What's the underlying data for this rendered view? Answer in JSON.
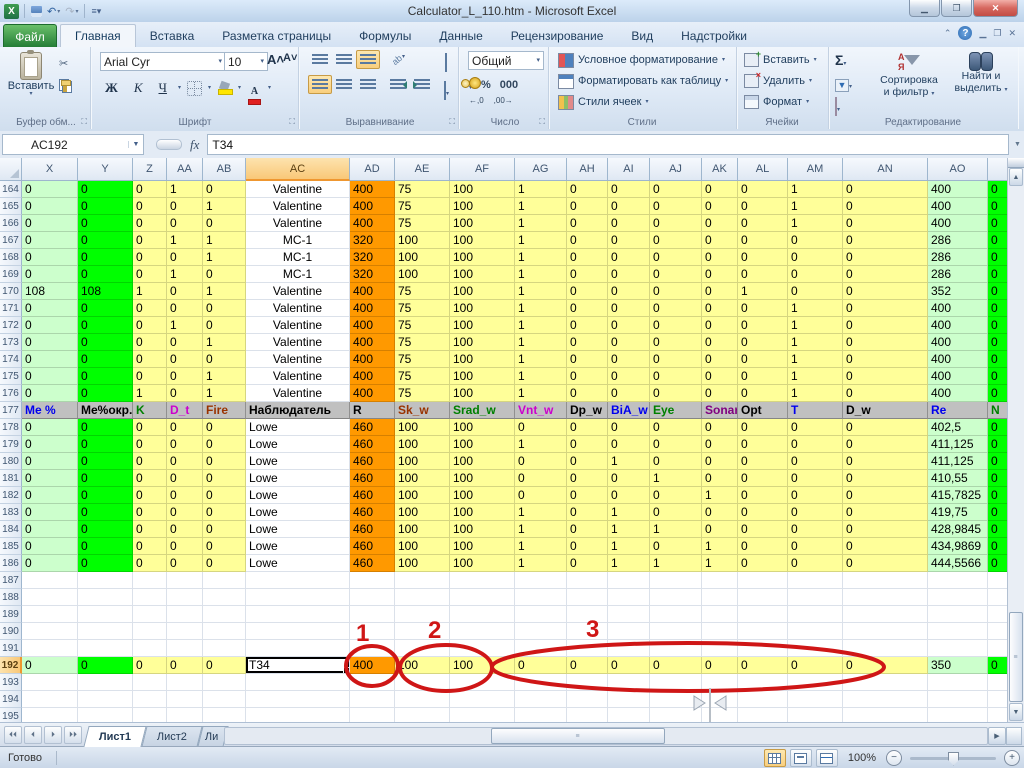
{
  "colors": {
    "pale_green": "#ccffcc",
    "bright_green": "#00ff00",
    "pale_yellow": "#ffff99",
    "orange": "#ff9900",
    "white": "#ffffff",
    "header_gray": "#c0c0c0",
    "annotation_red": "#cf1616",
    "selected_header_amber": "#f9c878"
  },
  "titlebar": {
    "title": "Calculator_L_110.htm  -  Microsoft Excel"
  },
  "tabs": {
    "file": "Файл",
    "items": [
      "Главная",
      "Вставка",
      "Разметка страницы",
      "Формулы",
      "Данные",
      "Рецензирование",
      "Вид",
      "Надстройки"
    ],
    "active": "Главная"
  },
  "ribbon": {
    "clipboard": {
      "paste": "Вставить",
      "label": "Буфер обм..."
    },
    "font": {
      "name": "Arial Cyr",
      "size": "10",
      "bold": "Ж",
      "italic": "К",
      "underline": "Ч",
      "label": "Шрифт"
    },
    "alignment": {
      "label": "Выравнивание"
    },
    "number": {
      "format": "Общий",
      "percent": "%",
      "zeros": "000",
      "inc_decimal": "←,0",
      "dec_decimal": ",00→",
      "label": "Число"
    },
    "styles": {
      "conditional": "Условное форматирование",
      "format_table": "Форматировать как таблицу",
      "cell_styles": "Стили ячеек",
      "label": "Стили"
    },
    "cells": {
      "insert": "Вставить",
      "delete": "Удалить",
      "format": "Формат",
      "label": "Ячейки"
    },
    "editing": {
      "sigma": "Σ",
      "sort": [
        "Сортировка",
        "и фильтр"
      ],
      "find": [
        "Найти и",
        "выделить"
      ],
      "label": "Редактирование"
    }
  },
  "formula_bar": {
    "name_box": "AC192",
    "fx": "fx",
    "value": "T34"
  },
  "grid": {
    "columns": [
      "X",
      "Y",
      "Z",
      "AA",
      "AB",
      "AC",
      "AD",
      "AE",
      "AF",
      "AG",
      "AH",
      "AI",
      "AJ",
      "AK",
      "AL",
      "AM",
      "AN",
      "AO"
    ],
    "selected_column": "AC",
    "selected_row": "192",
    "column_fills": [
      "pale_green",
      "bright_green",
      "pale_yellow",
      "pale_yellow",
      "pale_yellow",
      "white",
      "orange",
      "pale_yellow",
      "pale_yellow",
      "pale_yellow",
      "pale_yellow",
      "pale_yellow",
      "pale_yellow",
      "pale_yellow",
      "pale_yellow",
      "pale_yellow",
      "pale_yellow",
      "pale_green",
      "bright_green"
    ],
    "header_row_styles": [
      "blue",
      "black",
      "green",
      "magenta",
      "brown",
      "black",
      "black",
      "brown",
      "green",
      "magenta",
      "black",
      "blue",
      "green",
      "purple",
      "black",
      "blue",
      "black",
      "blue",
      "green"
    ],
    "rows": [
      {
        "n": "164",
        "type": "data",
        "ac": "center",
        "cells": [
          "0",
          "0",
          "0",
          "1",
          "0",
          "Valentine",
          "400",
          "75",
          "100",
          "1",
          "0",
          "0",
          "0",
          "0",
          "0",
          "1",
          "0",
          "400",
          "0"
        ]
      },
      {
        "n": "165",
        "type": "data",
        "ac": "center",
        "cells": [
          "0",
          "0",
          "0",
          "0",
          "1",
          "Valentine",
          "400",
          "75",
          "100",
          "1",
          "0",
          "0",
          "0",
          "0",
          "0",
          "1",
          "0",
          "400",
          "0"
        ]
      },
      {
        "n": "166",
        "type": "data",
        "ac": "center",
        "cells": [
          "0",
          "0",
          "0",
          "0",
          "0",
          "Valentine",
          "400",
          "75",
          "100",
          "1",
          "0",
          "0",
          "0",
          "0",
          "0",
          "1",
          "0",
          "400",
          "0"
        ]
      },
      {
        "n": "167",
        "type": "data",
        "ac": "center",
        "cells": [
          "0",
          "0",
          "0",
          "1",
          "1",
          "MC-1",
          "320",
          "100",
          "100",
          "1",
          "0",
          "0",
          "0",
          "0",
          "0",
          "0",
          "0",
          "286",
          "0"
        ]
      },
      {
        "n": "168",
        "type": "data",
        "ac": "center",
        "cells": [
          "0",
          "0",
          "0",
          "0",
          "1",
          "MC-1",
          "320",
          "100",
          "100",
          "1",
          "0",
          "0",
          "0",
          "0",
          "0",
          "0",
          "0",
          "286",
          "0"
        ]
      },
      {
        "n": "169",
        "type": "data",
        "ac": "center",
        "cells": [
          "0",
          "0",
          "0",
          "1",
          "0",
          "MC-1",
          "320",
          "100",
          "100",
          "1",
          "0",
          "0",
          "0",
          "0",
          "0",
          "0",
          "0",
          "286",
          "0"
        ]
      },
      {
        "n": "170",
        "type": "data",
        "ac": "center",
        "cells": [
          "108",
          "108",
          "1",
          "0",
          "1",
          "Valentine",
          "400",
          "75",
          "100",
          "1",
          "0",
          "0",
          "0",
          "0",
          "1",
          "0",
          "0",
          "352",
          "0"
        ]
      },
      {
        "n": "171",
        "type": "data",
        "ac": "center",
        "cells": [
          "0",
          "0",
          "0",
          "0",
          "0",
          "Valentine",
          "400",
          "75",
          "100",
          "1",
          "0",
          "0",
          "0",
          "0",
          "0",
          "1",
          "0",
          "400",
          "0"
        ]
      },
      {
        "n": "172",
        "type": "data",
        "ac": "center",
        "cells": [
          "0",
          "0",
          "0",
          "1",
          "0",
          "Valentine",
          "400",
          "75",
          "100",
          "1",
          "0",
          "0",
          "0",
          "0",
          "0",
          "1",
          "0",
          "400",
          "0"
        ]
      },
      {
        "n": "173",
        "type": "data",
        "ac": "center",
        "cells": [
          "0",
          "0",
          "0",
          "0",
          "1",
          "Valentine",
          "400",
          "75",
          "100",
          "1",
          "0",
          "0",
          "0",
          "0",
          "0",
          "1",
          "0",
          "400",
          "0"
        ]
      },
      {
        "n": "174",
        "type": "data",
        "ac": "center",
        "cells": [
          "0",
          "0",
          "0",
          "0",
          "0",
          "Valentine",
          "400",
          "75",
          "100",
          "1",
          "0",
          "0",
          "0",
          "0",
          "0",
          "1",
          "0",
          "400",
          "0"
        ]
      },
      {
        "n": "175",
        "type": "data",
        "ac": "center",
        "cells": [
          "0",
          "0",
          "0",
          "0",
          "1",
          "Valentine",
          "400",
          "75",
          "100",
          "1",
          "0",
          "0",
          "0",
          "0",
          "0",
          "1",
          "0",
          "400",
          "0"
        ]
      },
      {
        "n": "176",
        "type": "data",
        "ac": "center",
        "cells": [
          "0",
          "0",
          "1",
          "0",
          "1",
          "Valentine",
          "400",
          "75",
          "100",
          "1",
          "0",
          "0",
          "0",
          "0",
          "0",
          "1",
          "0",
          "400",
          "0"
        ]
      },
      {
        "n": "177",
        "type": "header",
        "cells": [
          "Me %",
          "Ме%окр.",
          "K",
          "D_t",
          "Fire",
          "Наблюдатель",
          "R",
          "Sk_w",
          "Srad_w",
          "Vnt_w",
          "Dp_w",
          "BiA_w",
          "Eye",
          "Sonar",
          "Opt",
          "T",
          "D_w",
          "Re",
          "N"
        ]
      },
      {
        "n": "178",
        "type": "data",
        "ac": "left",
        "cells": [
          "0",
          "0",
          "0",
          "0",
          "0",
          "Lowe",
          "460",
          "100",
          "100",
          "0",
          "0",
          "0",
          "0",
          "0",
          "0",
          "0",
          "0",
          "402,5",
          "0"
        ]
      },
      {
        "n": "179",
        "type": "data",
        "ac": "left",
        "cells": [
          "0",
          "0",
          "0",
          "0",
          "0",
          "Lowe",
          "460",
          "100",
          "100",
          "1",
          "0",
          "0",
          "0",
          "0",
          "0",
          "0",
          "0",
          "411,125",
          "0"
        ]
      },
      {
        "n": "180",
        "type": "data",
        "ac": "left",
        "cells": [
          "0",
          "0",
          "0",
          "0",
          "0",
          "Lowe",
          "460",
          "100",
          "100",
          "0",
          "0",
          "1",
          "0",
          "0",
          "0",
          "0",
          "0",
          "411,125",
          "0"
        ]
      },
      {
        "n": "181",
        "type": "data",
        "ac": "left",
        "cells": [
          "0",
          "0",
          "0",
          "0",
          "0",
          "Lowe",
          "460",
          "100",
          "100",
          "0",
          "0",
          "0",
          "1",
          "0",
          "0",
          "0",
          "0",
          "410,55",
          "0"
        ]
      },
      {
        "n": "182",
        "type": "data",
        "ac": "left",
        "cells": [
          "0",
          "0",
          "0",
          "0",
          "0",
          "Lowe",
          "460",
          "100",
          "100",
          "0",
          "0",
          "0",
          "0",
          "1",
          "0",
          "0",
          "0",
          "415,7825",
          "0"
        ]
      },
      {
        "n": "183",
        "type": "data",
        "ac": "left",
        "cells": [
          "0",
          "0",
          "0",
          "0",
          "0",
          "Lowe",
          "460",
          "100",
          "100",
          "1",
          "0",
          "1",
          "0",
          "0",
          "0",
          "0",
          "0",
          "419,75",
          "0"
        ]
      },
      {
        "n": "184",
        "type": "data",
        "ac": "left",
        "cells": [
          "0",
          "0",
          "0",
          "0",
          "0",
          "Lowe",
          "460",
          "100",
          "100",
          "1",
          "0",
          "1",
          "1",
          "0",
          "0",
          "0",
          "0",
          "428,9845",
          "0"
        ]
      },
      {
        "n": "185",
        "type": "data",
        "ac": "left",
        "cells": [
          "0",
          "0",
          "0",
          "0",
          "0",
          "Lowe",
          "460",
          "100",
          "100",
          "1",
          "0",
          "1",
          "0",
          "1",
          "0",
          "0",
          "0",
          "434,9869",
          "0"
        ]
      },
      {
        "n": "186",
        "type": "data",
        "ac": "left",
        "cells": [
          "0",
          "0",
          "0",
          "0",
          "0",
          "Lowe",
          "460",
          "100",
          "100",
          "1",
          "0",
          "1",
          "1",
          "1",
          "0",
          "0",
          "0",
          "444,5566",
          "0"
        ]
      },
      {
        "n": "187",
        "type": "empty"
      },
      {
        "n": "188",
        "type": "empty"
      },
      {
        "n": "189",
        "type": "empty"
      },
      {
        "n": "190",
        "type": "empty"
      },
      {
        "n": "191",
        "type": "empty"
      },
      {
        "n": "192",
        "type": "data",
        "ac": "left",
        "active": 5,
        "cells": [
          "0",
          "0",
          "0",
          "0",
          "0",
          "T34",
          "400",
          "100",
          "100",
          "0",
          "0",
          "0",
          "0",
          "0",
          "0",
          "0",
          "0",
          "350",
          "0"
        ]
      },
      {
        "n": "193",
        "type": "empty"
      },
      {
        "n": "194",
        "type": "empty"
      },
      {
        "n": "195",
        "type": "empty"
      }
    ]
  },
  "annotations": [
    "1",
    "2",
    "3"
  ],
  "sheet_tabs": {
    "items": [
      "Лист1",
      "Лист2",
      "Ли"
    ],
    "active": "Лист1"
  },
  "status_bar": {
    "mode": "Готово",
    "zoom": "100%"
  }
}
